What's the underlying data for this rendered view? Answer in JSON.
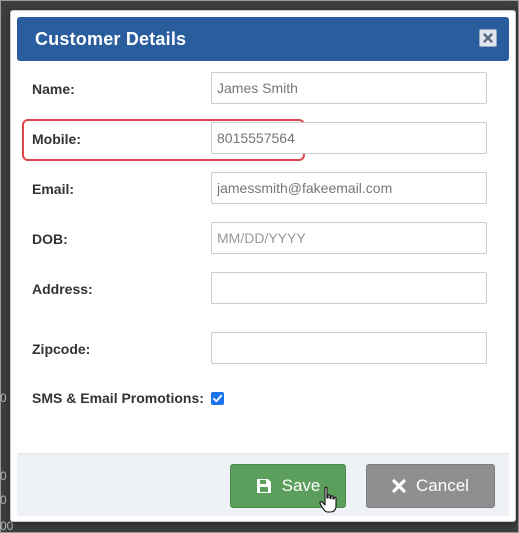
{
  "dialog": {
    "title": "Customer Details",
    "fields": [
      {
        "label": "Name:",
        "value": "James Smith",
        "placeholder": ""
      },
      {
        "label": "Mobile:",
        "value": "8015557564",
        "placeholder": ""
      },
      {
        "label": "Email:",
        "value": "jamessmith@fakeemail.com",
        "placeholder": ""
      },
      {
        "label": "DOB:",
        "value": "",
        "placeholder": "MM/DD/YYYY"
      },
      {
        "label": "Address:",
        "value": "",
        "placeholder": ""
      },
      {
        "label": "Zipcode:",
        "value": "",
        "placeholder": ""
      }
    ],
    "promotions": {
      "label": "SMS & Email Promotions:",
      "checked": true
    },
    "buttons": {
      "save": "Save",
      "cancel": "Cancel"
    }
  },
  "background": {
    "edge_text": [
      "0",
      "0",
      "0",
      "00"
    ]
  },
  "colors": {
    "header": "#2a5d9e",
    "save": "#5c9e5b",
    "cancel": "#8f8f8f",
    "highlight": "#e0474c",
    "checkbox": "#1a73e8"
  }
}
